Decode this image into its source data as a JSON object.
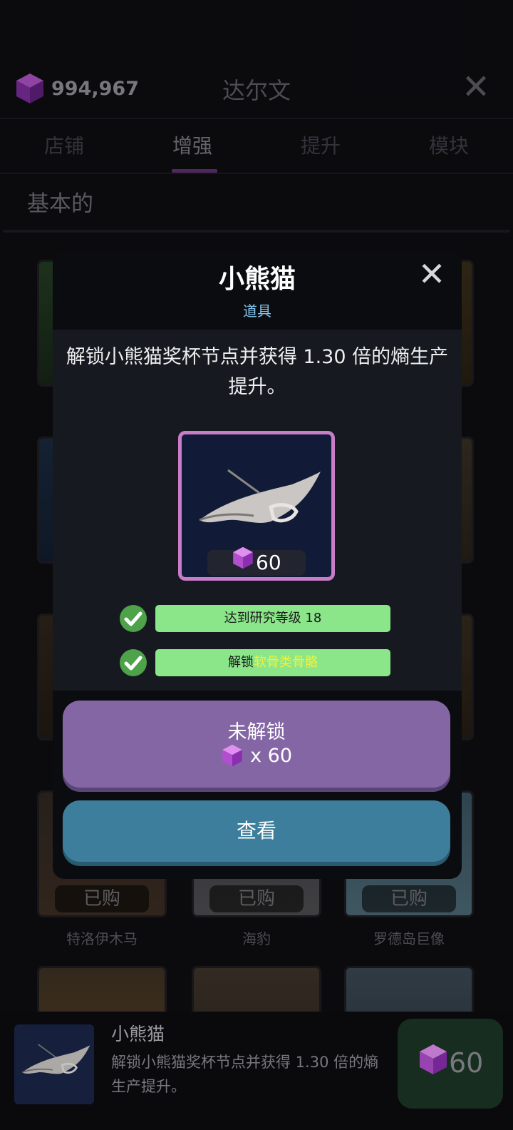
{
  "currency": {
    "value": "994,967",
    "icon": "purple-cube-icon"
  },
  "header": {
    "title": "达尔文",
    "close_icon": "close-icon"
  },
  "tabs": [
    {
      "label": "店铺",
      "active": false
    },
    {
      "label": "增强",
      "active": true
    },
    {
      "label": "提升",
      "active": false
    },
    {
      "label": "模块",
      "active": false
    }
  ],
  "section": {
    "title": "基本的"
  },
  "grid": {
    "bought_label": "已购",
    "row4_labels": [
      "特洛伊木马",
      "海豹",
      "罗德岛巨像"
    ],
    "row5_badges": [
      "",
      "已购",
      ""
    ]
  },
  "modal": {
    "title": "小熊猫",
    "subtitle": "道具",
    "description": "解锁小熊猫奖杯节点并获得 1.30 倍的熵生产提升。",
    "item_price": "60",
    "requirements": [
      {
        "text": "达到研究等级 18",
        "met": true
      },
      {
        "prefix": "解锁",
        "highlight": "软骨类骨骼",
        "met": true
      }
    ],
    "unlock_button": {
      "label": "未解锁",
      "cost": "x 60"
    },
    "view_button": {
      "label": "查看"
    }
  },
  "preview": {
    "name": "小熊猫",
    "description": "解锁小熊猫奖杯节点并获得 1.30 倍的熵生产提升。",
    "price": "60"
  },
  "colors": {
    "accent_purple": "#8466a5",
    "view_blue": "#3c7e9b",
    "requirement_green": "#8be68a",
    "check_green": "#4da24a",
    "highlight_yellow": "#f2f23a",
    "subtitle_blue": "#88c6ef"
  }
}
